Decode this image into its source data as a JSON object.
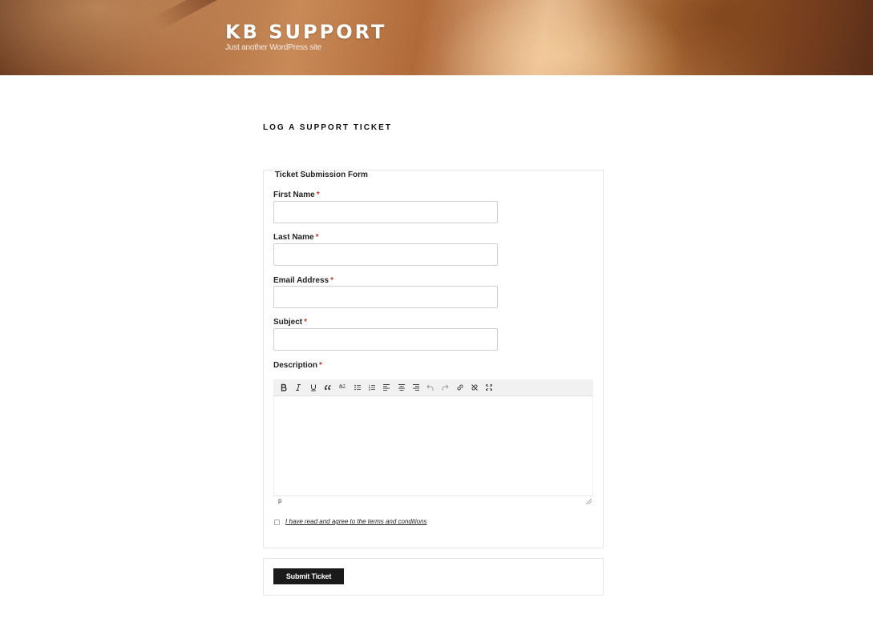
{
  "header": {
    "site_title": "KB SUPPORT",
    "site_description": "Just another WordPress site"
  },
  "page": {
    "title": "LOG A SUPPORT TICKET"
  },
  "form": {
    "legend": "Ticket Submission Form",
    "required_marker": "*",
    "fields": [
      {
        "label": "First Name",
        "value": ""
      },
      {
        "label": "Last Name",
        "value": ""
      },
      {
        "label": "Email Address",
        "value": ""
      },
      {
        "label": "Subject",
        "value": ""
      }
    ],
    "description": {
      "label": "Description",
      "toolbar": [
        "bold-icon",
        "italic-icon",
        "underline-icon",
        "blockquote-icon",
        "strikethrough-icon",
        "bullet-list-icon",
        "numbered-list-icon",
        "align-left-icon",
        "align-center-icon",
        "align-right-icon",
        "undo-icon",
        "redo-icon",
        "link-icon",
        "unlink-icon",
        "fullscreen-icon"
      ],
      "status_path": "p"
    },
    "terms_text": "I have read and agree to the terms and conditions",
    "terms_checked": false,
    "submit_label": "Submit Ticket"
  },
  "colors": {
    "required": "#c0392b",
    "button_bg": "#1a1a1a",
    "border": "#e6e6e6"
  }
}
